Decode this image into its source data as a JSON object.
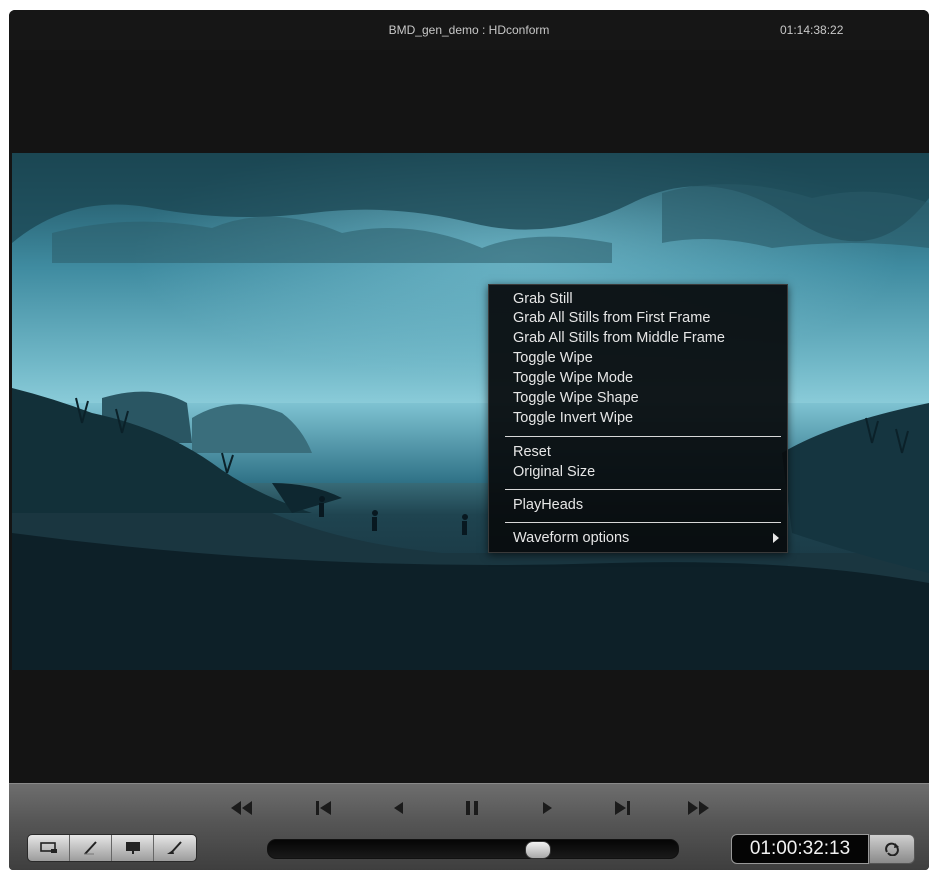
{
  "header": {
    "clip_title": "BMD_gen_demo : HDconform",
    "timecode": "01:14:38:22"
  },
  "context_menu": {
    "group1": [
      "Grab Still",
      "Grab All Stills from First Frame",
      "Grab All Stills from Middle Frame",
      "Toggle Wipe",
      "Toggle Wipe Mode",
      "Toggle Wipe Shape",
      "Toggle Invert Wipe"
    ],
    "group2": [
      "Reset",
      "Original Size"
    ],
    "group3": [
      "PlayHeads"
    ],
    "group4": [
      "Waveform options"
    ]
  },
  "transport": {
    "buttons": [
      "rewind-icon",
      "jump-to-start-icon",
      "play-reverse-icon",
      "pause-icon",
      "play-icon",
      "jump-to-end-icon",
      "fast-forward-icon"
    ],
    "tools": [
      "viewer-icon",
      "pen-icon",
      "monitor-icon",
      "brush-icon"
    ],
    "timecode": "01:00:32:13",
    "loop_icon": "loop-icon",
    "playhead_position": 0.67
  },
  "colors": {
    "panel_background": "#141414",
    "frame_teal": "#6fb6c6",
    "menu_background": "#080c0e",
    "menu_text": "#e6e6e6"
  }
}
